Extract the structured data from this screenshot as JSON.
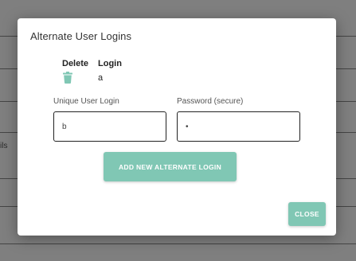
{
  "background": {
    "partial_text": "ils"
  },
  "modal": {
    "title": "Alternate User Logins",
    "table": {
      "headers": {
        "delete": "Delete",
        "login": "Login"
      },
      "rows": [
        {
          "login": "a",
          "icon": "trash-icon"
        }
      ]
    },
    "fields": {
      "unique_login": {
        "label": "Unique User Login",
        "value": "b"
      },
      "password": {
        "label": "Password (secure)",
        "value": "•"
      }
    },
    "add_button": "ADD NEW ALTERNATE LOGIN",
    "close_button": "CLOSE"
  },
  "colors": {
    "accent": "#80c7b4",
    "overlay": "#7f7f7f"
  }
}
